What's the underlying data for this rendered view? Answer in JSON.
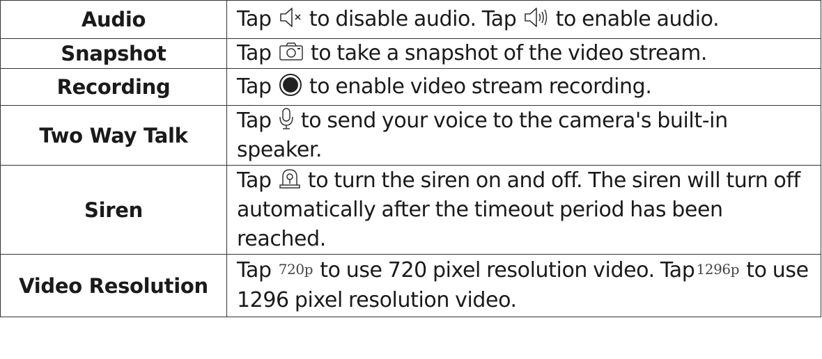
{
  "rows": [
    {
      "label": "Audio",
      "segments": [
        "Tap ",
        " to disable audio. Tap ",
        " to enable audio."
      ],
      "icons": [
        "speaker-muted-icon",
        "speaker-on-icon"
      ]
    },
    {
      "label": "Snapshot",
      "segments": [
        "Tap ",
        " to take a snapshot of the video stream."
      ],
      "icons": [
        "camera-icon"
      ]
    },
    {
      "label": "Recording",
      "segments": [
        "Tap ",
        " to enable video stream recording."
      ],
      "icons": [
        "record-icon"
      ]
    },
    {
      "label": "Two Way Talk",
      "segments": [
        "Tap ",
        " to send your voice to the camera's built-in speaker."
      ],
      "icons": [
        "microphone-icon"
      ]
    },
    {
      "label": "Siren",
      "segments": [
        "Tap ",
        " to turn the siren on and off. The siren will turn off automatically after the timeout period has been reached."
      ],
      "icons": [
        "siren-icon"
      ]
    },
    {
      "label": "Video Resolution",
      "segments": [
        "Tap ",
        " to use 720 pixel resolution video. Tap",
        " to use 1296 pixel resolution video."
      ],
      "resolution_labels": [
        "720p",
        "1296p"
      ]
    }
  ]
}
